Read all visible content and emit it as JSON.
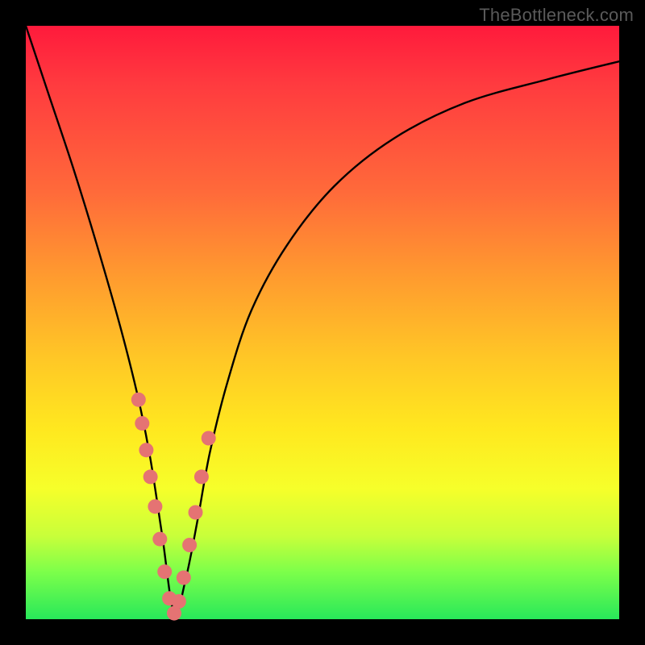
{
  "domain": "Chart",
  "watermark": "TheBottleneck.com",
  "colors": {
    "frame_bg": "#000000",
    "curve": "#000000",
    "marker_fill": "#e57373",
    "marker_stroke": "#c94f4f",
    "gradient_top": "#ff1a3c",
    "gradient_mid1": "#ff9a2f",
    "gradient_mid2": "#ffe81f",
    "gradient_bottom": "#28e85a"
  },
  "chart_data": {
    "type": "line",
    "title": "",
    "xlabel": "",
    "ylabel": "",
    "ylim": [
      0,
      100
    ],
    "xlim": [
      0,
      100
    ],
    "note": "V-shaped bottleneck curve. Minimum (optimal match) occurs near x≈25, y≈0. Values estimated from pixel positions on a 0–100 grid; no axis tick labels are present.",
    "series": [
      {
        "name": "bottleneck-curve",
        "x": [
          0,
          4,
          8,
          12,
          16,
          19,
          21,
          23,
          25,
          27,
          29,
          31,
          34,
          38,
          44,
          52,
          62,
          74,
          88,
          100
        ],
        "y": [
          100,
          88,
          76,
          63,
          49,
          37,
          27,
          14,
          1,
          7,
          17,
          28,
          40,
          52,
          63,
          73,
          81,
          87,
          91,
          94
        ]
      }
    ],
    "markers": {
      "name": "highlighted-points",
      "x": [
        19.0,
        19.6,
        20.3,
        21.0,
        21.8,
        22.6,
        23.4,
        24.2,
        25.0,
        25.8,
        26.6,
        27.6,
        28.6,
        29.6,
        30.8
      ],
      "y": [
        37.0,
        33.0,
        28.5,
        24.0,
        19.0,
        13.5,
        8.0,
        3.5,
        1.0,
        3.0,
        7.0,
        12.5,
        18.0,
        24.0,
        30.5
      ]
    }
  }
}
